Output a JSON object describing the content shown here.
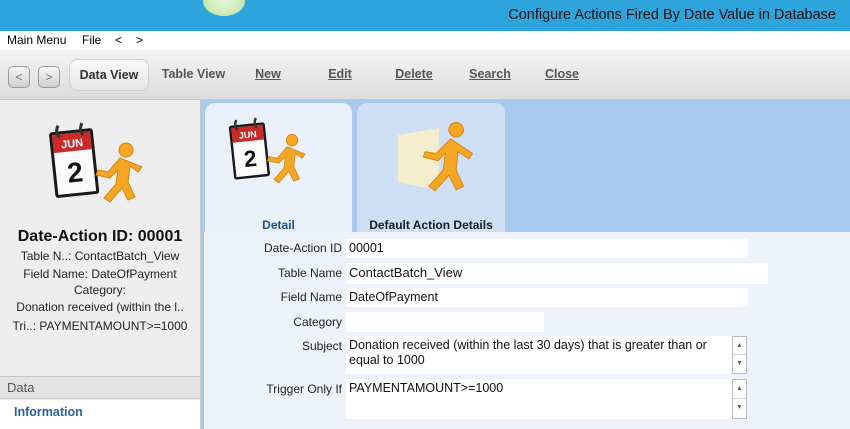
{
  "window": {
    "title": "Configure Actions Fired By Date Value in Database"
  },
  "menu": {
    "main_menu": "Main Menu",
    "file": "File",
    "back": "<",
    "forward": ">"
  },
  "toolbar": {
    "back": "<",
    "forward": ">",
    "data_view": "Data View",
    "table_view": "Table View",
    "new_label": "New",
    "edit_label": "Edit",
    "delete_label": "Delete",
    "search_label": "Search",
    "close_label": "Close"
  },
  "summary": {
    "id_title": "Date-Action ID: 00001",
    "table_line": "Table N..: ContactBatch_View",
    "field_line": "Field Name: DateOfPayment",
    "category_line": "Category:",
    "subject_line": "Donation received (within the l..",
    "trigger_line": "Tri..: PAYMENTAMOUNT>=1000"
  },
  "sections": {
    "data": "Data",
    "information": "Information"
  },
  "tabs": {
    "detail": "Detail",
    "default_action": "Default Action Details"
  },
  "calendar_icon": {
    "month": "JUN",
    "day": "2"
  },
  "form": {
    "date_action_id_label": "Date-Action ID",
    "date_action_id": "00001",
    "table_name_label": "Table Name",
    "table_name": "ContactBatch_View",
    "field_name_label": "Field Name",
    "field_name": "DateOfPayment",
    "category_label": "Category",
    "category": "",
    "subject_label": "Subject",
    "subject": "Donation received (within the last 30 days) that is greater than or equal to 1000",
    "trigger_label": "Trigger Only If",
    "trigger": "PAYMENTAMOUNT>=1000"
  },
  "colors": {
    "titlebar": "#2ea4dd",
    "panel_blue": "#a9c9ef",
    "runner_orange": "#f5a623",
    "accent_red": "#cc2a2a"
  }
}
